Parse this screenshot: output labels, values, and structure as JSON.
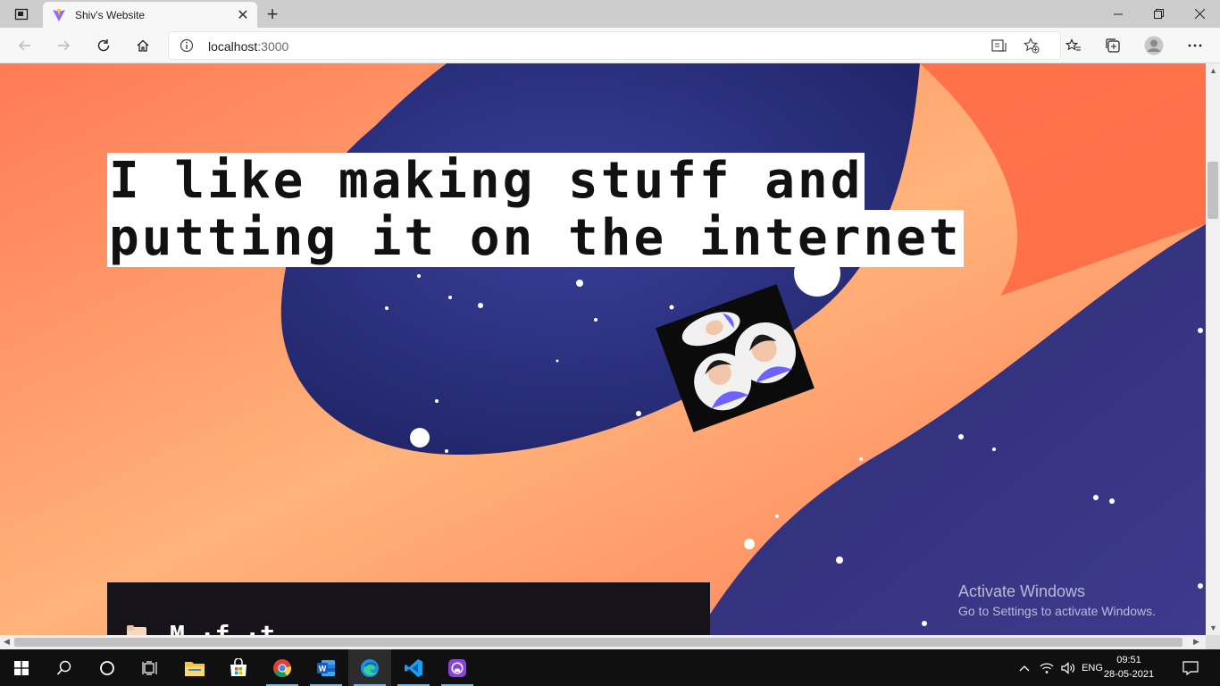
{
  "browser": {
    "tab": {
      "title": "Shiv's Website"
    },
    "address": {
      "host": "localhost",
      "port": ":3000"
    }
  },
  "page": {
    "headline_line1": "I like making stuff and",
    "headline_line2": "putting it on the internet",
    "panel_text": "M ·f ·t"
  },
  "watermark": {
    "line1": "Activate Windows",
    "line2": "Go to Settings to activate Windows."
  },
  "taskbar": {
    "language": "ENG",
    "time": "09:51",
    "date": "28-05-2021"
  },
  "colors": {
    "page_orange": "#ff7a52",
    "space_blue": "#2a2f7a",
    "taskbar": "#101010",
    "accent": "#76b9ed"
  }
}
